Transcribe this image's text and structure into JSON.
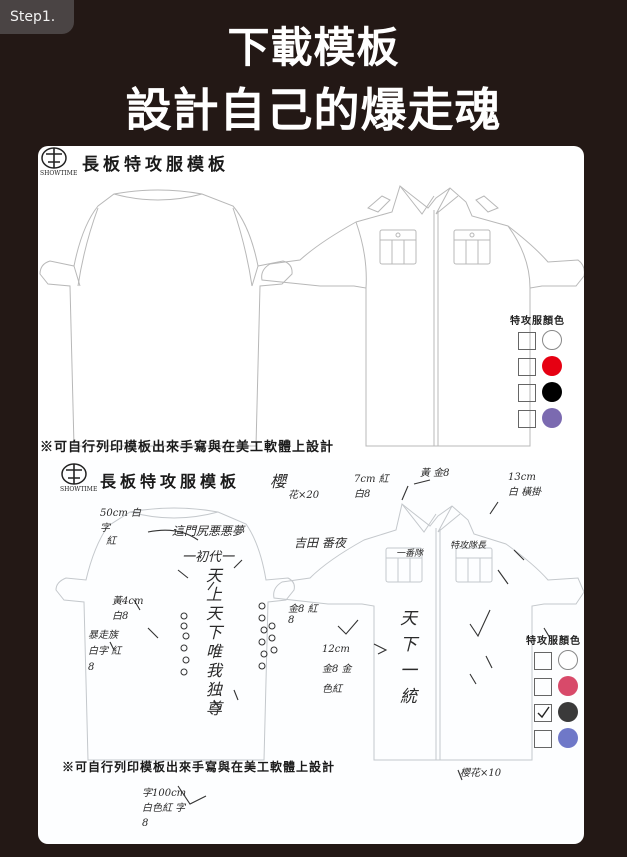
{
  "step_label": "Step1.",
  "headline": {
    "line1": "下載模板",
    "line2": "設計自己的爆走魂"
  },
  "template_blank": {
    "logo_text": "SHOWTIME",
    "title": "長板特攻服模板",
    "palette_title": "特攻服顏色",
    "palette_colors": [
      "#ffffff",
      "#e60012",
      "#000000",
      "#7b6ab0"
    ],
    "footer_note": "※可自行列印模板出來手寫與在美工軟體上設計"
  },
  "template_example": {
    "logo_text": "SHOWTIME",
    "title": "長板特攻服模板",
    "palette_title": "特攻服顏色",
    "palette_colors": [
      "#ffffff",
      "#d84a6a",
      "#3a3a3a",
      "#6f78c8"
    ],
    "checked_index": 2,
    "footer_note": "※可自行列印模板出來手寫與在美工軟體上設計",
    "handwritten": {
      "title_suffix": "櫻",
      "flower_note": "花×20",
      "left_size": "50cm 白字",
      "left_color": "紅",
      "chest_top": "這門尻悪悪夢",
      "generation": "一初代一",
      "vertical_left": "天上天下唯我独尊",
      "yellow_note": "黃4cm 白8",
      "left_sleeve": "暴走族 白字 紅8",
      "center_mid": "吉田 番夜",
      "center_side": "金8 紅8",
      "seven_cm": "7cm 紅 白8",
      "yellow_gold": "黃 金8",
      "pocket_left": "一番隊",
      "pocket_right": "特攻隊長",
      "vertical_right": "天下一統",
      "twelve_cm": "12cm 金8 金色紅",
      "right_top": "13cm 白 橫掛",
      "bottom_flower": "櫻花×10",
      "bottom_size": "字100cm 白色紅 字8"
    }
  }
}
